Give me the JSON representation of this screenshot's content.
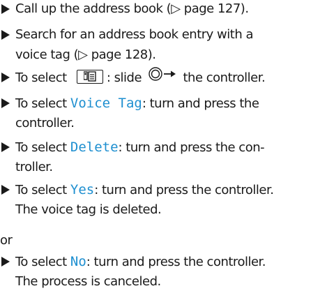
{
  "steps": [
    {
      "lines": [
        [
          "Call up the address book (",
          "▷",
          " page 127)."
        ]
      ]
    },
    {
      "lines": [
        [
          "Search for an address book entry with a"
        ],
        [
          "voice tag (",
          "▷",
          " page 128)."
        ]
      ]
    },
    {
      "parts": {
        "pre": "To select ",
        "mid": ": slide ",
        "post": " the controller."
      }
    },
    {
      "parts": {
        "pre": "To select ",
        "menu": "Voice Tag",
        "post": ": turn and press the"
      },
      "cont": "controller."
    },
    {
      "parts": {
        "pre": "To select ",
        "menu": "Delete",
        "post": ": turn and press the con-"
      },
      "cont": "troller."
    },
    {
      "parts": {
        "pre": "To select ",
        "menu": "Yes",
        "post": ": turn and press the controller."
      },
      "cont": "The voice tag is deleted."
    },
    {
      "parts": {
        "pre": "To select ",
        "menu": "No",
        "post": ": turn and press the controller."
      },
      "cont": "The process is canceled."
    }
  ],
  "or_text": "or",
  "colors": {
    "text": "#1a1a1a",
    "menu_accent": "#1e8fd0"
  },
  "icons": [
    "bullet-triangle-icon",
    "phonebook-key-icon",
    "controller-slide-right-icon"
  ]
}
